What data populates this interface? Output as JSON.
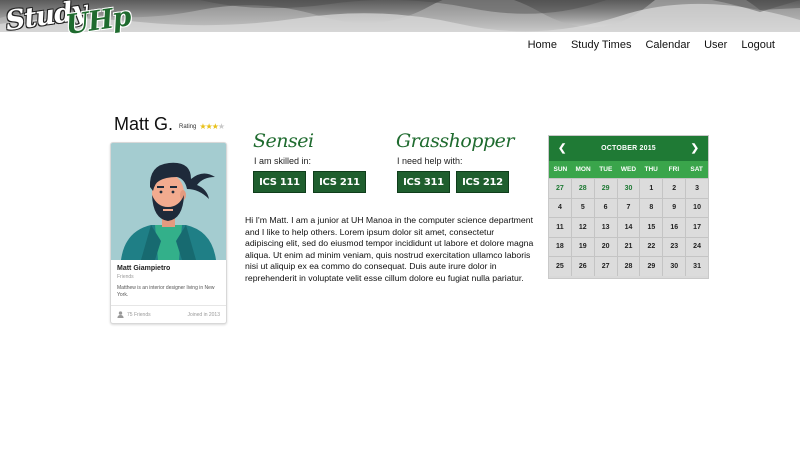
{
  "brand": {
    "word1": "Study",
    "word2": "UHp"
  },
  "nav": [
    {
      "label": "Home"
    },
    {
      "label": "Study Times"
    },
    {
      "label": "Calendar"
    },
    {
      "label": "User"
    },
    {
      "label": "Logout"
    }
  ],
  "profile": {
    "name": "Matt G.",
    "rating_label": "Rating",
    "rating": 3,
    "rating_max": 4,
    "card": {
      "name": "Matt Giampietro",
      "subtitle": "Friends",
      "description": "Matthew is an interior designer living in New York.",
      "friends": "75 Friends",
      "joined": "Joined in 2013"
    }
  },
  "sensei": {
    "heading": "Sensei",
    "subheading": "I am skilled in:",
    "courses": [
      "ICS 111",
      "ICS 211"
    ]
  },
  "grasshopper": {
    "heading": "Grasshopper",
    "subheading": "I need help with:",
    "courses": [
      "ICS 311",
      "ICS 212"
    ]
  },
  "bio": "Hi I'm Matt. I am a junior at UH Manoa in the computer science department and I like to help others. Lorem ipsum dolor sit amet, consectetur adipiscing elit, sed do eiusmod tempor incididunt ut labore et dolore magna aliqua. Ut enim ad minim veniam, quis nostrud exercitation ullamco laboris nisi ut aliquip ex ea commo do consequat. Duis aute irure dolor in reprehenderit in voluptate velit esse cillum dolore eu fugiat nulla pariatur.",
  "calendar": {
    "month_label": "OCTOBER 2015",
    "prev_icon": "chevron-left-icon",
    "next_icon": "chevron-right-icon",
    "weekdays": [
      "SUN",
      "MON",
      "TUE",
      "WED",
      "THU",
      "FRI",
      "SAT"
    ],
    "weeks": [
      [
        "27",
        "28",
        "29",
        "30",
        "1",
        "2",
        "3"
      ],
      [
        "4",
        "5",
        "6",
        "7",
        "8",
        "9",
        "10"
      ],
      [
        "11",
        "12",
        "13",
        "14",
        "15",
        "16",
        "17"
      ],
      [
        "18",
        "19",
        "20",
        "21",
        "22",
        "23",
        "24"
      ],
      [
        "25",
        "26",
        "27",
        "28",
        "29",
        "30",
        "31"
      ]
    ],
    "prev_month_days": 4
  },
  "colors": {
    "brand_green": "#1f6b2f",
    "badge_green": "#1f5e2e",
    "calendar_header": "#1f7a35",
    "calendar_weekday": "#3aa54b",
    "star": "#e8c11a"
  }
}
